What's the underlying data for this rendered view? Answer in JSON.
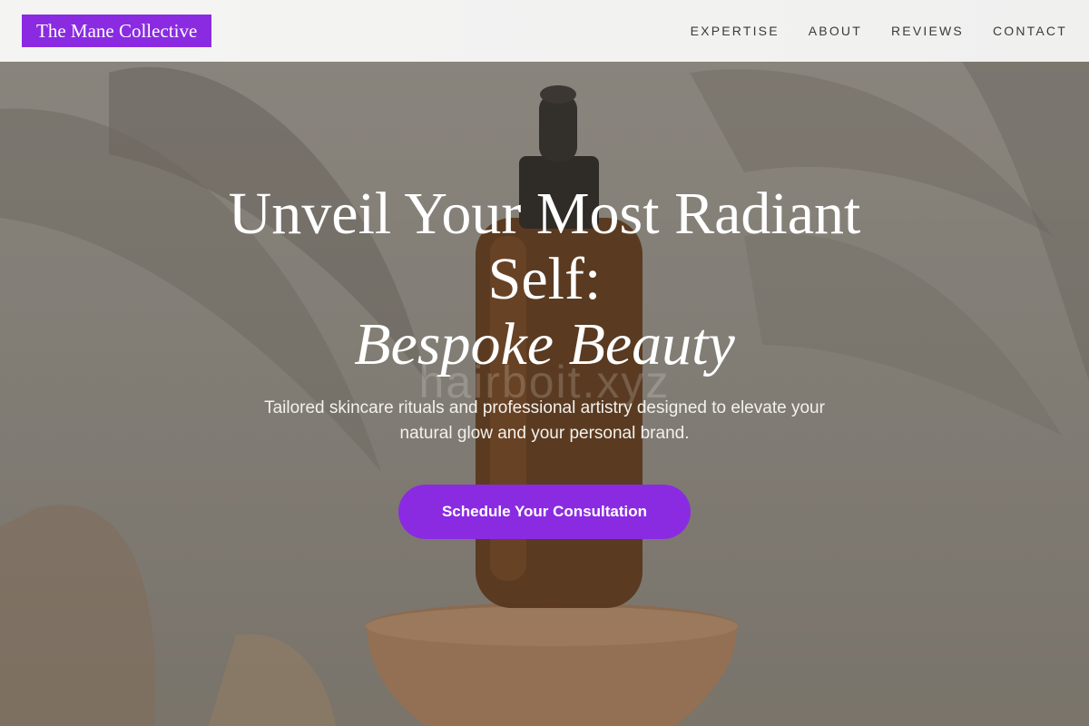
{
  "header": {
    "brand": "The Mane Collective",
    "nav": [
      {
        "label": "EXPERTISE"
      },
      {
        "label": "ABOUT"
      },
      {
        "label": "REVIEWS"
      },
      {
        "label": "CONTACT"
      }
    ]
  },
  "hero": {
    "headline_line1": "Unveil Your Most Radiant Self:",
    "headline_accent": "Bespoke Beauty",
    "watermark": "hairboit.xyz",
    "subtitle": "Tailored skincare rituals and professional artistry designed to elevate your natural glow and your personal brand.",
    "cta_label": "Schedule Your Consultation"
  },
  "colors": {
    "accent": "#8a2be2",
    "header_bg": "#f3f3f2",
    "text_light": "#ffffff"
  }
}
